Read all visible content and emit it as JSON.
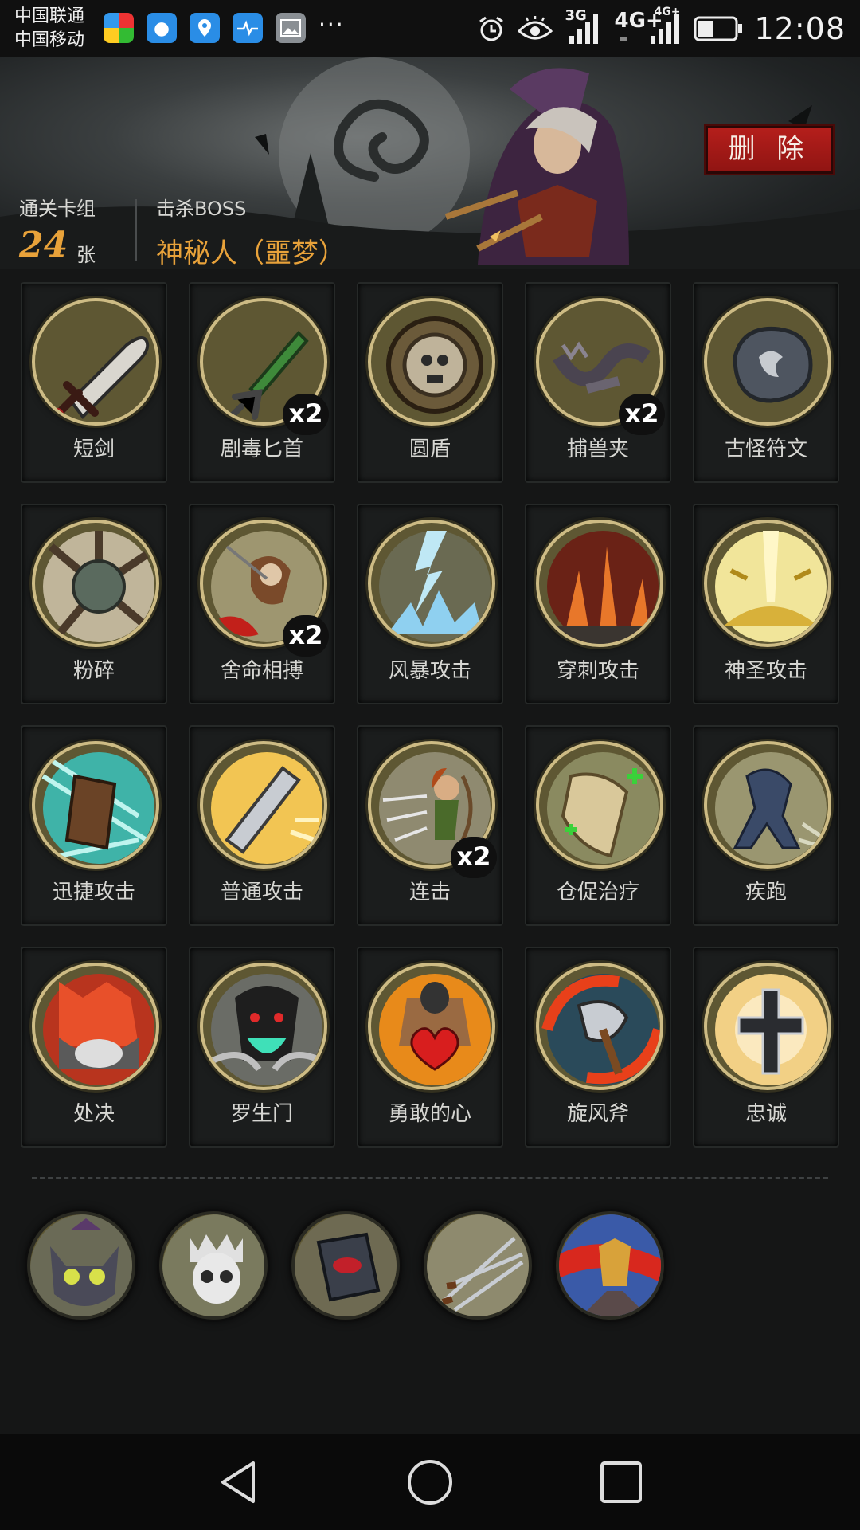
{
  "statusbar": {
    "carrier_1": "中国联通",
    "carrier_2": "中国移动",
    "network_1": "3G",
    "network_2": "4G+",
    "network_3": "4G+",
    "time": "12:08",
    "app_icons": [
      "browser-app-icon",
      "qq-browser-app-icon",
      "maps-app-icon",
      "health-app-icon",
      "gallery-app-icon"
    ],
    "more": "···"
  },
  "header": {
    "cards_label": "通关卡组",
    "cards_count": "24",
    "cards_unit": "张",
    "boss_label": "击杀BOSS",
    "boss_name": "神秘人（噩梦）",
    "delete_label": "删 除"
  },
  "cards": [
    {
      "name": "短剑",
      "icon": "dagger-icon",
      "count": ""
    },
    {
      "name": "剧毒匕首",
      "icon": "poison-dagger-icon",
      "count": "x2"
    },
    {
      "name": "圆盾",
      "icon": "round-shield-icon",
      "count": ""
    },
    {
      "name": "捕兽夹",
      "icon": "bear-trap-icon",
      "count": "x2"
    },
    {
      "name": "古怪符文",
      "icon": "rune-stone-icon",
      "count": ""
    },
    {
      "name": "粉碎",
      "icon": "smash-icon",
      "count": ""
    },
    {
      "name": "舍命相搏",
      "icon": "desperate-fight-icon",
      "count": "x2"
    },
    {
      "name": "风暴攻击",
      "icon": "storm-attack-icon",
      "count": ""
    },
    {
      "name": "穿刺攻击",
      "icon": "pierce-attack-icon",
      "count": ""
    },
    {
      "name": "神圣攻击",
      "icon": "holy-attack-icon",
      "count": ""
    },
    {
      "name": "迅捷攻击",
      "icon": "swift-attack-icon",
      "count": ""
    },
    {
      "name": "普通攻击",
      "icon": "basic-attack-icon",
      "count": ""
    },
    {
      "name": "连击",
      "icon": "combo-icon",
      "count": "x2"
    },
    {
      "name": "仓促治疗",
      "icon": "hasty-heal-icon",
      "count": ""
    },
    {
      "name": "疾跑",
      "icon": "sprint-icon",
      "count": ""
    },
    {
      "name": "处决",
      "icon": "execute-icon",
      "count": ""
    },
    {
      "name": "罗生门",
      "icon": "rashomon-icon",
      "count": ""
    },
    {
      "name": "勇敢的心",
      "icon": "brave-heart-icon",
      "count": ""
    },
    {
      "name": "旋风斧",
      "icon": "whirlwind-axe-icon",
      "count": ""
    },
    {
      "name": "忠诚",
      "icon": "loyalty-cross-icon",
      "count": ""
    }
  ],
  "relics": [
    "cat-relic-icon",
    "crowned-skull-relic-icon",
    "red-book-relic-icon",
    "thrown-daggers-relic-icon",
    "warrior-banner-relic-icon"
  ],
  "colors": {
    "accent_orange": "#e8a23a",
    "delete_red": "#a81a17",
    "emblem_olive": "#5e5733",
    "emblem_ring": "#cdbb84",
    "card_bg": "#1b1d1d"
  }
}
